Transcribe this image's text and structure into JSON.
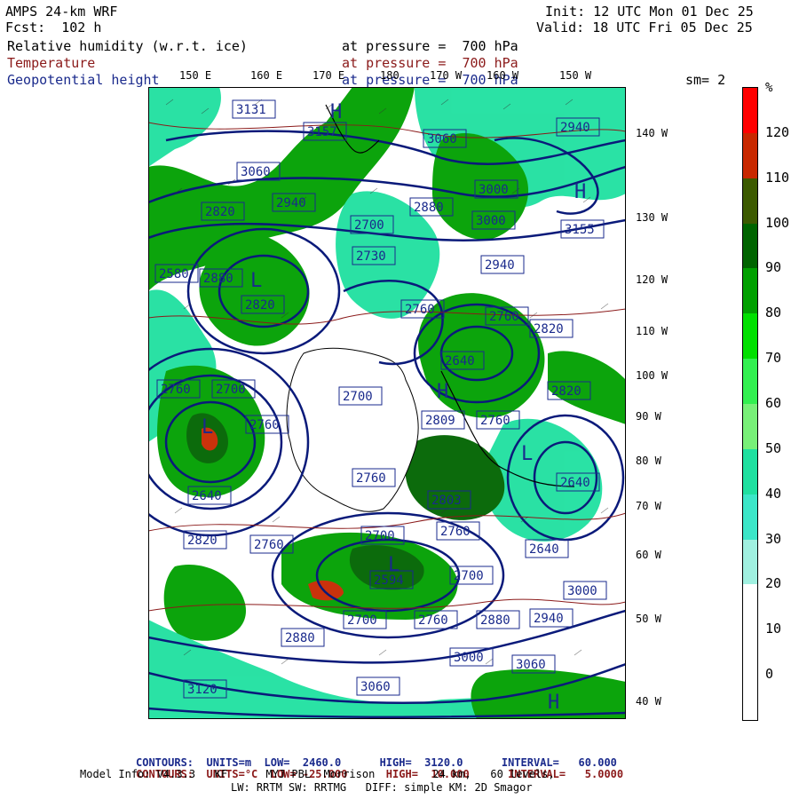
{
  "header": {
    "model": "AMPS 24-km WRF",
    "fcst": "Fcst:  102 h",
    "init": "Init: 12 UTC Mon 01 Dec 25",
    "valid": "Valid: 18 UTC Fri 05 Dec 25",
    "field1": "Relative humidity (w.r.t. ice)",
    "field2": "Temperature",
    "field3": "Geopotential height",
    "pressure1": "at pressure =  700 hPa",
    "pressure2": "at pressure =  700 hPa",
    "pressure3": "at pressure =  700 hPa",
    "smooth": "sm= 2"
  },
  "lon_labels_top": [
    "150 E",
    "160 E",
    "170 E",
    "180",
    "170 W",
    "160 W",
    "150 W"
  ],
  "lat_labels_right": [
    "140 W",
    "130 W",
    "120 W",
    "110 W",
    "100 W",
    "90 W",
    "80 W",
    "70 W",
    "60 W",
    "50 W",
    "40 W"
  ],
  "colorbar": {
    "unit": "%",
    "labels": [
      "120",
      "110",
      "100",
      "90",
      "80",
      "70",
      "60",
      "50",
      "40",
      "30",
      "20",
      "10",
      "0"
    ],
    "colors": [
      "#ff0000",
      "#c82800",
      "#3c5a00",
      "#006400",
      "#00a000",
      "#00e000",
      "#32f050",
      "#78f078",
      "#1fe0a0",
      "#3ce6c8",
      "#a0f0e0",
      "#ffffff",
      "#ffffff",
      "#ffffff"
    ]
  },
  "height_labels": [
    "3131",
    "3157",
    "3060",
    "3060",
    "3000",
    "2940",
    "2880",
    "2820",
    "2700",
    "2730",
    "2880",
    "2940",
    "3000",
    "3155",
    "2820",
    "2760",
    "2760",
    "2820",
    "2640",
    "2820",
    "2760",
    "2700",
    "2809",
    "2760",
    "2760",
    "2700",
    "2760",
    "2640",
    "2803",
    "2820",
    "2760",
    "2700",
    "2760",
    "2640",
    "2594",
    "2700",
    "2760",
    "2880",
    "2940",
    "2880",
    "2700",
    "3000",
    "3060",
    "3060",
    "3120",
    "3000",
    "2640",
    "2580",
    "2940"
  ],
  "footer": {
    "c1_label": "CONTOURS:",
    "c1_units": "UNITS=m",
    "c1_low": "LOW=  2460.0",
    "c1_high": "HIGH=  3120.0",
    "c1_interval": "INTERVAL=   60.000",
    "c2_label": "CONTOURS:",
    "c2_units": "UNITS=°C",
    "c2_low": "LOW= -25.000",
    "c2_high": "HIGH=  10.000",
    "c2_interval": "INTERVAL=   5.0000",
    "model_info": "Model Info: V4.3.3   KF      MYJ PBL  Morrison         24 km,   60 levels,",
    "physics": "LW: RRTM SW: RRTMG   DIFF: simple KM: 2D Smagor"
  }
}
